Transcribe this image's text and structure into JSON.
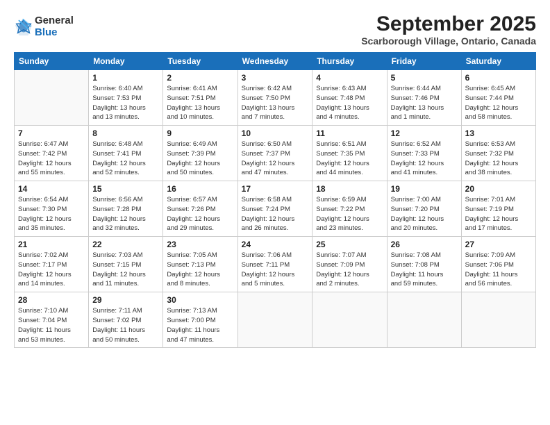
{
  "logo": {
    "general": "General",
    "blue": "Blue"
  },
  "header": {
    "title": "September 2025",
    "subtitle": "Scarborough Village, Ontario, Canada"
  },
  "weekdays": [
    "Sunday",
    "Monday",
    "Tuesday",
    "Wednesday",
    "Thursday",
    "Friday",
    "Saturday"
  ],
  "weeks": [
    [
      {
        "day": "",
        "info": ""
      },
      {
        "day": "1",
        "info": "Sunrise: 6:40 AM\nSunset: 7:53 PM\nDaylight: 13 hours\nand 13 minutes."
      },
      {
        "day": "2",
        "info": "Sunrise: 6:41 AM\nSunset: 7:51 PM\nDaylight: 13 hours\nand 10 minutes."
      },
      {
        "day": "3",
        "info": "Sunrise: 6:42 AM\nSunset: 7:50 PM\nDaylight: 13 hours\nand 7 minutes."
      },
      {
        "day": "4",
        "info": "Sunrise: 6:43 AM\nSunset: 7:48 PM\nDaylight: 13 hours\nand 4 minutes."
      },
      {
        "day": "5",
        "info": "Sunrise: 6:44 AM\nSunset: 7:46 PM\nDaylight: 13 hours\nand 1 minute."
      },
      {
        "day": "6",
        "info": "Sunrise: 6:45 AM\nSunset: 7:44 PM\nDaylight: 12 hours\nand 58 minutes."
      }
    ],
    [
      {
        "day": "7",
        "info": "Sunrise: 6:47 AM\nSunset: 7:42 PM\nDaylight: 12 hours\nand 55 minutes."
      },
      {
        "day": "8",
        "info": "Sunrise: 6:48 AM\nSunset: 7:41 PM\nDaylight: 12 hours\nand 52 minutes."
      },
      {
        "day": "9",
        "info": "Sunrise: 6:49 AM\nSunset: 7:39 PM\nDaylight: 12 hours\nand 50 minutes."
      },
      {
        "day": "10",
        "info": "Sunrise: 6:50 AM\nSunset: 7:37 PM\nDaylight: 12 hours\nand 47 minutes."
      },
      {
        "day": "11",
        "info": "Sunrise: 6:51 AM\nSunset: 7:35 PM\nDaylight: 12 hours\nand 44 minutes."
      },
      {
        "day": "12",
        "info": "Sunrise: 6:52 AM\nSunset: 7:33 PM\nDaylight: 12 hours\nand 41 minutes."
      },
      {
        "day": "13",
        "info": "Sunrise: 6:53 AM\nSunset: 7:32 PM\nDaylight: 12 hours\nand 38 minutes."
      }
    ],
    [
      {
        "day": "14",
        "info": "Sunrise: 6:54 AM\nSunset: 7:30 PM\nDaylight: 12 hours\nand 35 minutes."
      },
      {
        "day": "15",
        "info": "Sunrise: 6:56 AM\nSunset: 7:28 PM\nDaylight: 12 hours\nand 32 minutes."
      },
      {
        "day": "16",
        "info": "Sunrise: 6:57 AM\nSunset: 7:26 PM\nDaylight: 12 hours\nand 29 minutes."
      },
      {
        "day": "17",
        "info": "Sunrise: 6:58 AM\nSunset: 7:24 PM\nDaylight: 12 hours\nand 26 minutes."
      },
      {
        "day": "18",
        "info": "Sunrise: 6:59 AM\nSunset: 7:22 PM\nDaylight: 12 hours\nand 23 minutes."
      },
      {
        "day": "19",
        "info": "Sunrise: 7:00 AM\nSunset: 7:20 PM\nDaylight: 12 hours\nand 20 minutes."
      },
      {
        "day": "20",
        "info": "Sunrise: 7:01 AM\nSunset: 7:19 PM\nDaylight: 12 hours\nand 17 minutes."
      }
    ],
    [
      {
        "day": "21",
        "info": "Sunrise: 7:02 AM\nSunset: 7:17 PM\nDaylight: 12 hours\nand 14 minutes."
      },
      {
        "day": "22",
        "info": "Sunrise: 7:03 AM\nSunset: 7:15 PM\nDaylight: 12 hours\nand 11 minutes."
      },
      {
        "day": "23",
        "info": "Sunrise: 7:05 AM\nSunset: 7:13 PM\nDaylight: 12 hours\nand 8 minutes."
      },
      {
        "day": "24",
        "info": "Sunrise: 7:06 AM\nSunset: 7:11 PM\nDaylight: 12 hours\nand 5 minutes."
      },
      {
        "day": "25",
        "info": "Sunrise: 7:07 AM\nSunset: 7:09 PM\nDaylight: 12 hours\nand 2 minutes."
      },
      {
        "day": "26",
        "info": "Sunrise: 7:08 AM\nSunset: 7:08 PM\nDaylight: 11 hours\nand 59 minutes."
      },
      {
        "day": "27",
        "info": "Sunrise: 7:09 AM\nSunset: 7:06 PM\nDaylight: 11 hours\nand 56 minutes."
      }
    ],
    [
      {
        "day": "28",
        "info": "Sunrise: 7:10 AM\nSunset: 7:04 PM\nDaylight: 11 hours\nand 53 minutes."
      },
      {
        "day": "29",
        "info": "Sunrise: 7:11 AM\nSunset: 7:02 PM\nDaylight: 11 hours\nand 50 minutes."
      },
      {
        "day": "30",
        "info": "Sunrise: 7:13 AM\nSunset: 7:00 PM\nDaylight: 11 hours\nand 47 minutes."
      },
      {
        "day": "",
        "info": ""
      },
      {
        "day": "",
        "info": ""
      },
      {
        "day": "",
        "info": ""
      },
      {
        "day": "",
        "info": ""
      }
    ]
  ]
}
